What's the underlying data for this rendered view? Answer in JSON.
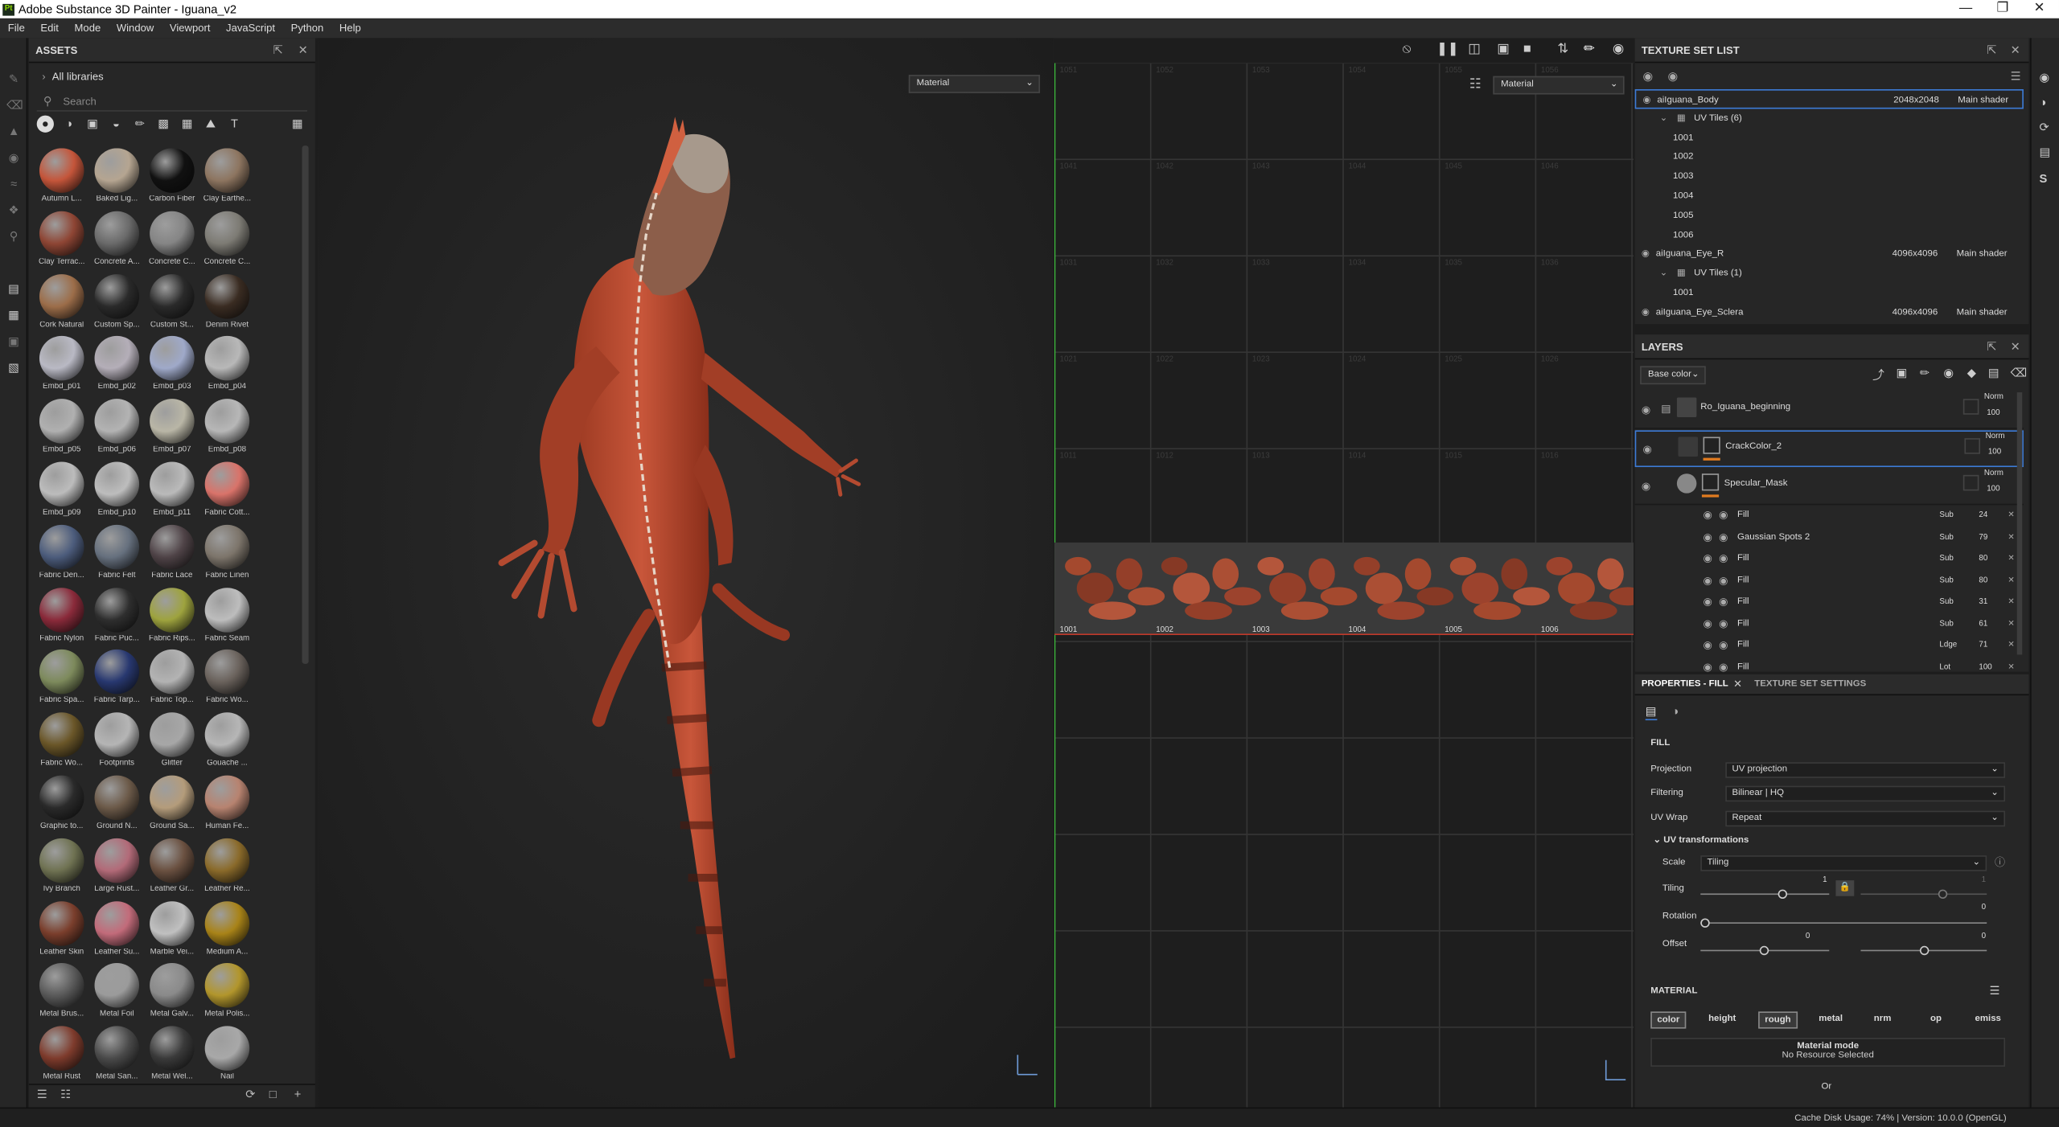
{
  "window": {
    "title": "Adobe Substance 3D Painter - Iguana_v2",
    "app_icon": "Pt"
  },
  "menu": [
    "File",
    "Edit",
    "Mode",
    "Window",
    "Viewport",
    "JavaScript",
    "Python",
    "Help"
  ],
  "assets": {
    "title": "ASSETS",
    "libraries": "All libraries",
    "search_placeholder": "Search",
    "items": [
      {
        "label": "Autumn L...",
        "color": "#c4553a"
      },
      {
        "label": "Baked Lig...",
        "color": "#b5a591"
      },
      {
        "label": "Carbon Fiber",
        "color": "#111111"
      },
      {
        "label": "Clay Earthe...",
        "color": "#8d7560"
      },
      {
        "label": "Clay Terrac...",
        "color": "#8e4534"
      },
      {
        "label": "Concrete A...",
        "color": "#6a6a6a"
      },
      {
        "label": "Concrete C...",
        "color": "#858585"
      },
      {
        "label": "Concrete C...",
        "color": "#7d7b74"
      },
      {
        "label": "Cork Natural",
        "color": "#9c6d49"
      },
      {
        "label": "Custom Sp...",
        "color": "#2a2a2a"
      },
      {
        "label": "Custom St...",
        "color": "#2a2a2a"
      },
      {
        "label": "Denim Rivet",
        "color": "#3a2c22"
      },
      {
        "label": "Embd_p01",
        "color": "#b9b9c4"
      },
      {
        "label": "Embd_p02",
        "color": "#b4aeb8"
      },
      {
        "label": "Embd_p03",
        "color": "#9fa9c9"
      },
      {
        "label": "Embd_p04",
        "color": "#b8b8b8"
      },
      {
        "label": "Embd_p05",
        "color": "#b0b0b0"
      },
      {
        "label": "Embd_p06",
        "color": "#b3b3b3"
      },
      {
        "label": "Embd_p07",
        "color": "#b9b6a6"
      },
      {
        "label": "Embd_p08",
        "color": "#b7b7b7"
      },
      {
        "label": "Embd_p09",
        "color": "#bcbcbc"
      },
      {
        "label": "Embd_p10",
        "color": "#bdbdbd"
      },
      {
        "label": "Embd_p11",
        "color": "#bababa"
      },
      {
        "label": "Fabric Cott...",
        "color": "#d9736a"
      },
      {
        "label": "Fabric Den...",
        "color": "#4c5c7c"
      },
      {
        "label": "Fabric Felt",
        "color": "#66707e"
      },
      {
        "label": "Fabric Lace",
        "color": "#4f4347"
      },
      {
        "label": "Fabric Linen",
        "color": "#7d756b"
      },
      {
        "label": "Fabric Nylon",
        "color": "#8a2a3a"
      },
      {
        "label": "Fabric Puc...",
        "color": "#2e2e2e"
      },
      {
        "label": "Fabric Rips...",
        "color": "#9ea33e"
      },
      {
        "label": "Fabric Seam",
        "color": "#bdbdbd"
      },
      {
        "label": "Fabric Spa...",
        "color": "#7d8a5c"
      },
      {
        "label": "Fabric Tarp...",
        "color": "#283870"
      },
      {
        "label": "Fabric Top...",
        "color": "#b3b3b3"
      },
      {
        "label": "Fabric Wo...",
        "color": "#6a625c"
      },
      {
        "label": "Fabric Wo...",
        "color": "#6a5628"
      },
      {
        "label": "Footprints",
        "color": "#b5b5b5"
      },
      {
        "label": "Glitter",
        "color": "#a7a7a7"
      },
      {
        "label": "Gouache ...",
        "color": "#b6b6b6"
      },
      {
        "label": "Graphic to...",
        "color": "#2a2a2a"
      },
      {
        "label": "Ground N...",
        "color": "#6c5a49"
      },
      {
        "label": "Ground Sa...",
        "color": "#b49c7b"
      },
      {
        "label": "Human Fe...",
        "color": "#b78370"
      },
      {
        "label": "Ivy Branch",
        "color": "#6f7252"
      },
      {
        "label": "Large Rust...",
        "color": "#b26a78"
      },
      {
        "label": "Leather Gr...",
        "color": "#6a5040"
      },
      {
        "label": "Leather Re...",
        "color": "#8a6a2a"
      },
      {
        "label": "Leather Skin",
        "color": "#7a3e2c"
      },
      {
        "label": "Leather Su...",
        "color": "#c26b7a"
      },
      {
        "label": "Marble Vei...",
        "color": "#c0c0c0"
      },
      {
        "label": "Medium A...",
        "color": "#a88318"
      },
      {
        "label": "Metal Brus...",
        "color": "#5a5a5a"
      },
      {
        "label": "Metal Foil",
        "color": "#9b9b9b"
      },
      {
        "label": "Metal Galv...",
        "color": "#8a8a8a"
      },
      {
        "label": "Metal Polis...",
        "color": "#b2962c"
      },
      {
        "label": "Metal Rust",
        "color": "#7e3b2c"
      },
      {
        "label": "Metal San...",
        "color": "#4a4a4a"
      },
      {
        "label": "Metal Wel...",
        "color": "#3a3a3a"
      },
      {
        "label": "Nail",
        "color": "#a8a8a8"
      }
    ]
  },
  "viewport": {
    "left_mode": "Material",
    "right_mode": "Material",
    "uv_tiles": [
      "1001",
      "1002",
      "1003",
      "1004",
      "1005",
      "1006"
    ],
    "grid_labels_row1": [
      "1051",
      "1052",
      "1053",
      "1054",
      "1055",
      "1056"
    ],
    "grid_labels_row2": [
      "1041",
      "1042",
      "1043",
      "1044",
      "1045",
      "1046"
    ],
    "grid_labels_row3": [
      "1031",
      "1032",
      "1033",
      "1034",
      "1035",
      "1036"
    ],
    "grid_labels_row4": [
      "1021",
      "1022",
      "1023",
      "1024",
      "1025",
      "1026"
    ],
    "grid_labels_row5": [
      "1011",
      "1012",
      "1013",
      "1014",
      "1015",
      "1016"
    ]
  },
  "texture_set_list": {
    "title": "TEXTURE SET LIST",
    "sets": [
      {
        "name": "aiIguana_Body",
        "size": "2048x2048",
        "shader": "Main shader",
        "uv_label": "UV Tiles (6)",
        "tiles": [
          "1001",
          "1002",
          "1003",
          "1004",
          "1005",
          "1006"
        ]
      },
      {
        "name": "aiIguana_Eye_R",
        "size": "4096x4096",
        "shader": "Main shader",
        "uv_label": "UV Tiles (1)",
        "tiles": [
          "1001"
        ]
      },
      {
        "name": "aiIguana_Eye_Sclera",
        "size": "4096x4096",
        "shader": "Main shader"
      }
    ]
  },
  "layers": {
    "title": "LAYERS",
    "channel": "Base color",
    "items": [
      {
        "name": "Ro_Iguana_beginning",
        "blend": "Norm",
        "opacity": "100"
      },
      {
        "name": "CrackColor_2",
        "blend": "Norm",
        "opacity": "100"
      },
      {
        "name": "Specular_Mask",
        "blend": "Norm",
        "opacity": "100"
      }
    ],
    "effects": [
      {
        "name": "Fill",
        "blend": "Sub",
        "value": "24"
      },
      {
        "name": "Gaussian Spots 2",
        "blend": "Sub",
        "value": "79"
      },
      {
        "name": "Fill",
        "blend": "Sub",
        "value": "80"
      },
      {
        "name": "Fill",
        "blend": "Sub",
        "value": "80"
      },
      {
        "name": "Fill",
        "blend": "Sub",
        "value": "31"
      },
      {
        "name": "Fill",
        "blend": "Sub",
        "value": "61"
      },
      {
        "name": "Fill",
        "blend": "Ldge",
        "value": "71"
      },
      {
        "name": "Fill",
        "blend": "Lot",
        "value": "100"
      }
    ]
  },
  "properties": {
    "tab_active": "PROPERTIES - FILL",
    "tab_other": "TEXTURE SET SETTINGS",
    "section": "FILL",
    "projection_label": "Projection",
    "projection": "UV projection",
    "filtering_label": "Filtering",
    "filtering": "Bilinear | HQ",
    "uvwrap_label": "UV Wrap",
    "uvwrap": "Repeat",
    "uvt_label": "UV transformations",
    "scale_label": "Scale",
    "scale": "Tiling",
    "tiling_label": "Tiling",
    "tiling_value": "1",
    "tiling_value2": "1",
    "rotation_label": "Rotation",
    "rotation_value": "0",
    "offset_label": "Offset",
    "offset_value": "0",
    "offset_value2": "0",
    "material_label": "MATERIAL",
    "channels": [
      "color",
      "height",
      "rough",
      "metal",
      "nrm",
      "op",
      "emiss"
    ],
    "material_mode": "Material mode",
    "no_resource": "No Resource Selected",
    "or": "Or"
  },
  "status": {
    "text": "Cache Disk Usage:   74% | Version: 10.0.0 (OpenGL)"
  }
}
